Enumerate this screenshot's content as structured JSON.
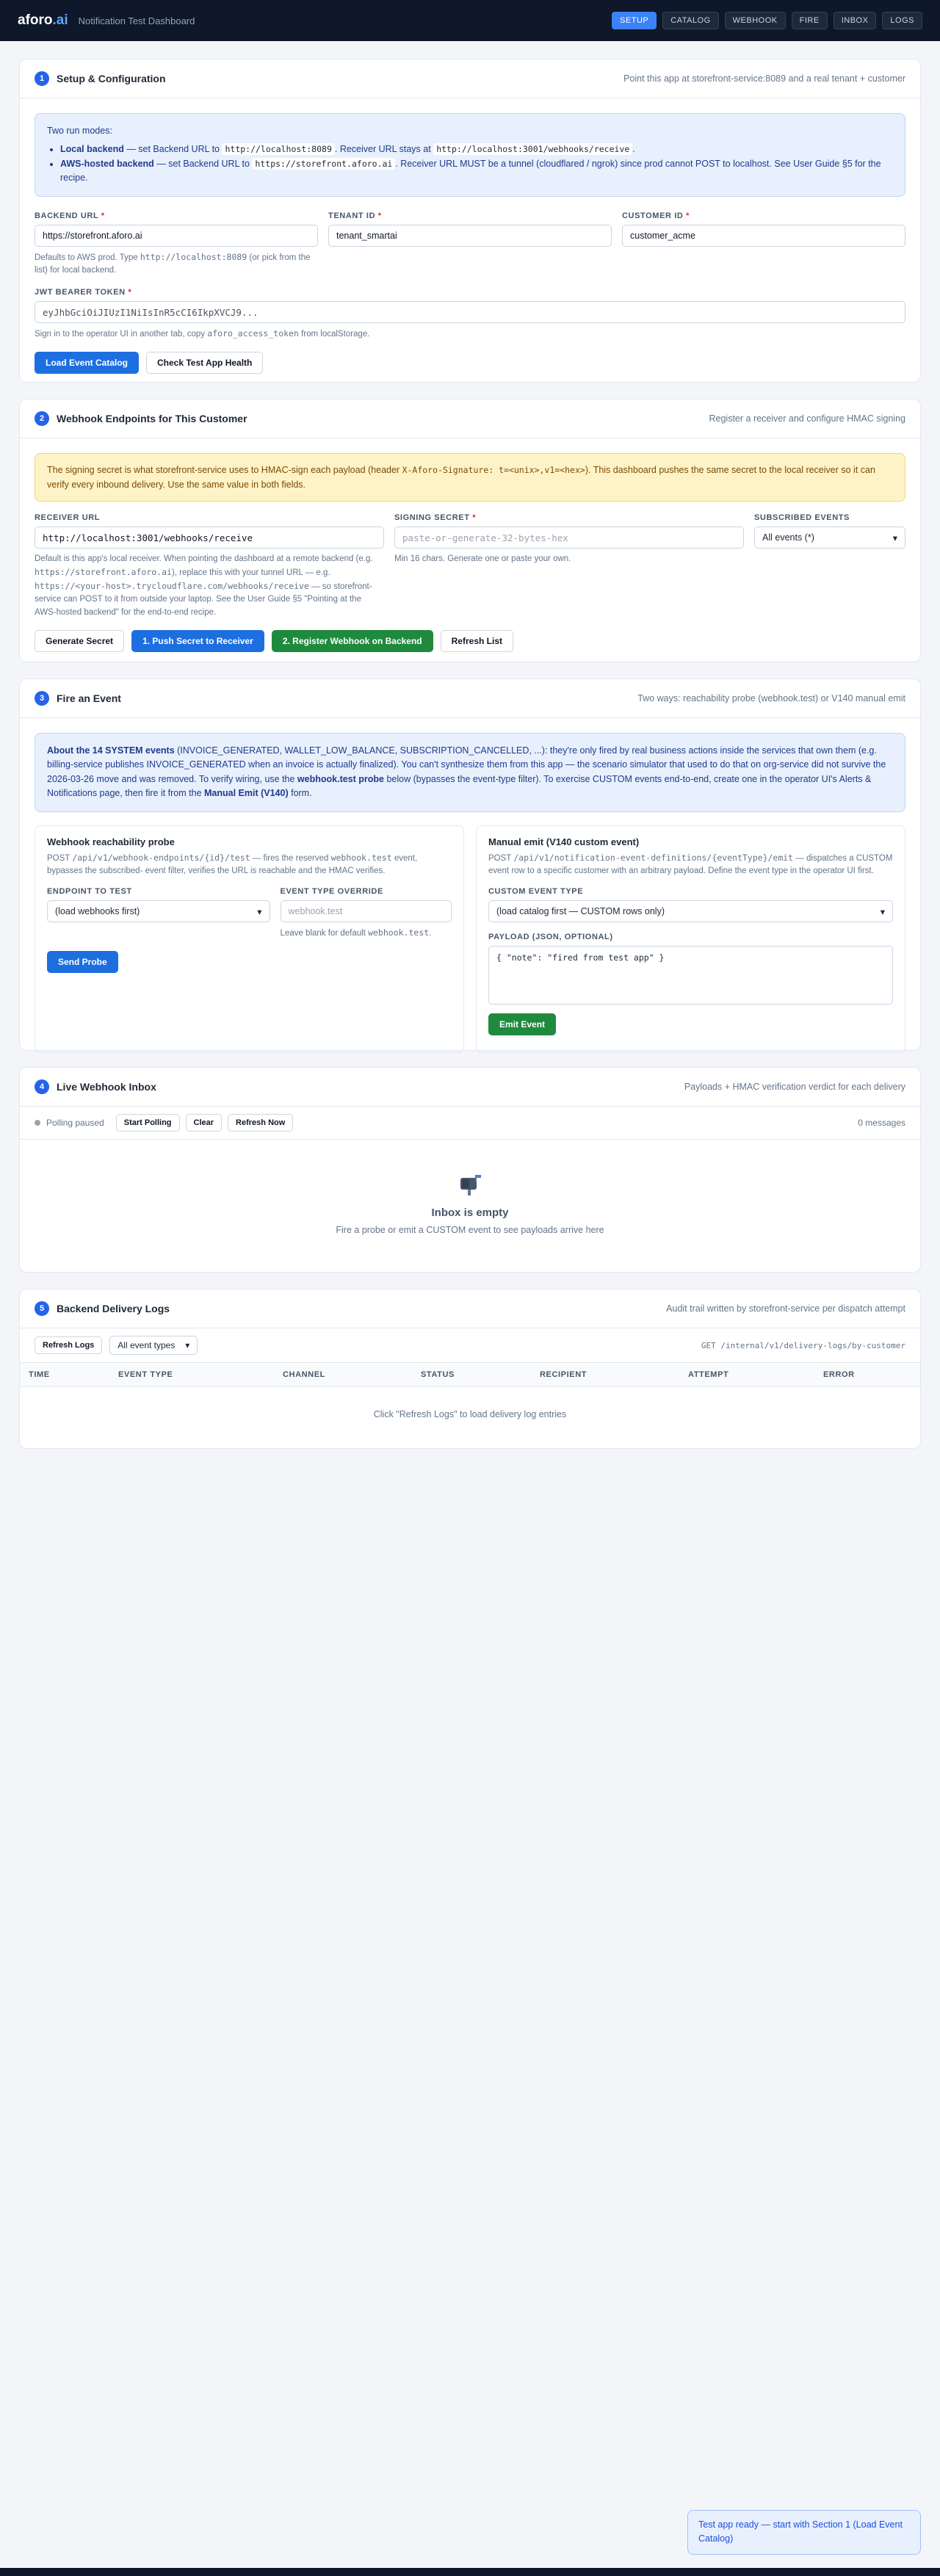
{
  "header": {
    "logo_main": "aforo",
    "logo_dot": ".ai",
    "title": "Notification Test Dashboard",
    "tabs": [
      "SETUP",
      "CATALOG",
      "WEBHOOK",
      "FIRE",
      "INBOX",
      "LOGS"
    ]
  },
  "s1": {
    "num": "1",
    "title": "Setup & Configuration",
    "sub": "Point this app at storefront-service:8089 and a real tenant + customer",
    "info_title": "Two run modes:",
    "info_b1_strong": "Local backend",
    "info_b1_t1": " — set Backend URL to ",
    "info_b1_c1": "http://localhost:8089",
    "info_b1_t2": ". Receiver URL stays at ",
    "info_b1_c2": "http://localhost:3001/webhooks/receive",
    "info_b1_t3": ".",
    "info_b2_strong": "AWS-hosted backend",
    "info_b2_t1": " — set Backend URL to ",
    "info_b2_c1": "https://storefront.aforo.ai",
    "info_b2_t2": ". Receiver URL MUST be a tunnel (cloudflared / ngrok) since prod cannot POST to localhost. See User Guide §5 for the recipe.",
    "backend_label": "BACKEND URL",
    "backend_value": "https://storefront.aforo.ai",
    "backend_hint_t1": "Defaults to AWS prod. Type ",
    "backend_hint_c": "http://localhost:8089",
    "backend_hint_t2": " (or pick from the list) for local backend.",
    "tenant_label": "TENANT ID",
    "tenant_value": "tenant_smartai",
    "customer_label": "CUSTOMER ID",
    "customer_value": "customer_acme",
    "jwt_label": "JWT BEARER TOKEN",
    "jwt_value": "eyJhbGciOiJIUzI1NiIsInR5cCI6IkpXVCJ9...",
    "jwt_hint_t1": "Sign in to the operator UI in another tab, copy ",
    "jwt_hint_c": "aforo_access_token",
    "jwt_hint_t2": " from localStorage.",
    "btn_load": "Load Event Catalog",
    "btn_health": "Check Test App Health"
  },
  "s2": {
    "num": "2",
    "title": "Webhook Endpoints for This Customer",
    "sub": "Register a receiver and configure HMAC signing",
    "warn_t1": "The signing secret is what storefront-service uses to HMAC-sign each payload (header ",
    "warn_c": "X-Aforo-Signature: t=<unix>,v1=<hex>",
    "warn_t2": "). This dashboard pushes the same secret to the local receiver so it can verify every inbound delivery. Use the same value in both fields.",
    "receiver_label": "RECEIVER URL",
    "receiver_value": "http://localhost:3001/webhooks/receive",
    "receiver_hint_t1": "Default is this app's local receiver. When pointing the dashboard at a remote backend (e.g. ",
    "receiver_hint_c1": "https://storefront.aforo.ai",
    "receiver_hint_t2": "), replace this with your tunnel URL — e.g. ",
    "receiver_hint_c2": "https://<your-host>.trycloudflare.com/webhooks/receive",
    "receiver_hint_t3": " — so storefront-service can POST to it from outside your laptop. See the User Guide §5 \"Pointing at the AWS-hosted backend\" for the end-to-end recipe.",
    "secret_label": "SIGNING SECRET",
    "secret_placeholder": "paste-or-generate-32-bytes-hex",
    "secret_hint": "Min 16 chars. Generate one or paste your own.",
    "events_label": "SUBSCRIBED EVENTS",
    "events_value": "All events (*)",
    "btn_generate": "Generate Secret",
    "btn_push": "1. Push Secret to Receiver",
    "btn_register": "2. Register Webhook on Backend",
    "btn_refresh": "Refresh List"
  },
  "s3": {
    "num": "3",
    "title": "Fire an Event",
    "sub": "Two ways: reachability probe (webhook.test) or V140 manual emit",
    "info_strong1": "About the 14 SYSTEM events",
    "info_t1": " (INVOICE_GENERATED, WALLET_LOW_BALANCE, SUBSCRIPTION_CANCELLED, ...): they're only fired by real business actions inside the services that own them (e.g. billing-service publishes INVOICE_GENERATED when an invoice is actually finalized). You can't synthesize them from this app — the scenario simulator that used to do that on org-service did not survive the 2026-03-26 move and was removed. To verify wiring, use the ",
    "info_strong2": "webhook.test probe",
    "info_t2": " below (bypasses the event-type filter). To exercise CUSTOM events end-to-end, create one in the operator UI's Alerts & Notifications page, then fire it from the ",
    "info_strong3": "Manual Emit (V140)",
    "info_t3": " form.",
    "probe_title": "Webhook reachability probe",
    "probe_desc_t1": "POST ",
    "probe_desc_c1": "/api/v1/webhook-endpoints/{id}/test",
    "probe_desc_t2": " — fires the reserved ",
    "probe_desc_c2": "webhook.test",
    "probe_desc_t3": " event, bypasses the subscribed- event filter, verifies the URL is reachable and the HMAC verifies.",
    "endpoint_label": "ENDPOINT TO TEST",
    "endpoint_value": "(load webhooks first)",
    "override_label": "EVENT TYPE OVERRIDE",
    "override_placeholder": "webhook.test",
    "override_hint_t1": "Leave blank for default ",
    "override_hint_c": "webhook.test",
    "override_hint_t2": ".",
    "btn_probe": "Send Probe",
    "emit_title": "Manual emit (V140 custom event)",
    "emit_desc_t1": "POST ",
    "emit_desc_c": "/api/v1/notification-event-definitions/{eventType}/emit",
    "emit_desc_t2": " — dispatches a CUSTOM event row to a specific customer with an arbitrary payload. Define the event type in the operator UI first.",
    "custom_label": "CUSTOM EVENT TYPE",
    "custom_value": "(load catalog first — CUSTOM rows only)",
    "payload_label": "PAYLOAD (JSON, OPTIONAL)",
    "payload_value": "{ \"note\": \"fired from test app\" }",
    "btn_emit": "Emit Event"
  },
  "s4": {
    "num": "4",
    "title": "Live Webhook Inbox",
    "sub": "Payloads + HMAC verification verdict for each delivery",
    "status": "Polling paused",
    "btn_start": "Start Polling",
    "btn_clear": "Clear",
    "btn_refresh": "Refresh Now",
    "count": "0 messages",
    "empty_title": "Inbox is empty",
    "empty_sub": "Fire a probe or emit a CUSTOM event to see payloads arrive here"
  },
  "s5": {
    "num": "5",
    "title": "Backend Delivery Logs",
    "sub": "Audit trail written by storefront-service per dispatch attempt",
    "btn_refresh": "Refresh Logs",
    "filter_value": "All event types",
    "endpoint": "GET /internal/v1/delivery-logs/by-customer",
    "columns": [
      "TIME",
      "EVENT TYPE",
      "CHANNEL",
      "STATUS",
      "RECIPIENT",
      "ATTEMPT",
      "ERROR"
    ],
    "empty": "Click \"Refresh Logs\" to load delivery log entries"
  },
  "toast": {
    "text": "Test app ready — start with Section 1 (Load Event Catalog)"
  }
}
